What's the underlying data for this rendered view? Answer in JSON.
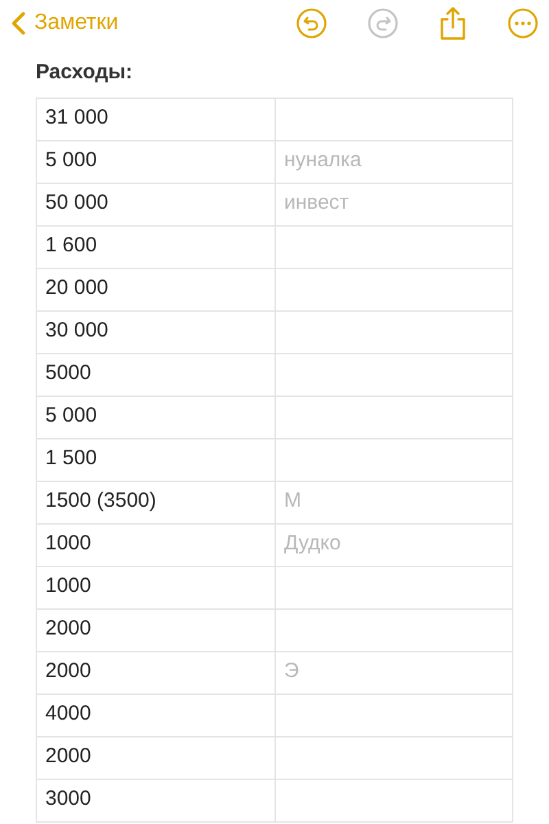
{
  "nav": {
    "back_label": "Заметки",
    "undo": {
      "disabled": false
    },
    "redo": {
      "disabled": true
    }
  },
  "note": {
    "heading": "Расходы:",
    "rows": [
      {
        "amount": "31 000",
        "item": ""
      },
      {
        "amount": "5 000",
        "item": "нуналка"
      },
      {
        "amount": "50 000",
        "item": "инвест"
      },
      {
        "amount": "1 600",
        "item": ""
      },
      {
        "amount": "20 000",
        "item": ""
      },
      {
        "amount": "30 000",
        "item": ""
      },
      {
        "amount": "5000",
        "item": ""
      },
      {
        "amount": "5 000",
        "item": ""
      },
      {
        "amount": "1 500",
        "item": ""
      },
      {
        "amount": "1500 (3500)",
        "item": "М"
      },
      {
        "amount": "1000",
        "item": "Дудко"
      },
      {
        "amount": "1000",
        "item": ""
      },
      {
        "amount": "2000",
        "item": ""
      },
      {
        "amount": "2000",
        "item": "Э"
      },
      {
        "amount": "4000",
        "item": ""
      },
      {
        "amount": "2000",
        "item": ""
      },
      {
        "amount": "3000",
        "item": ""
      }
    ]
  }
}
